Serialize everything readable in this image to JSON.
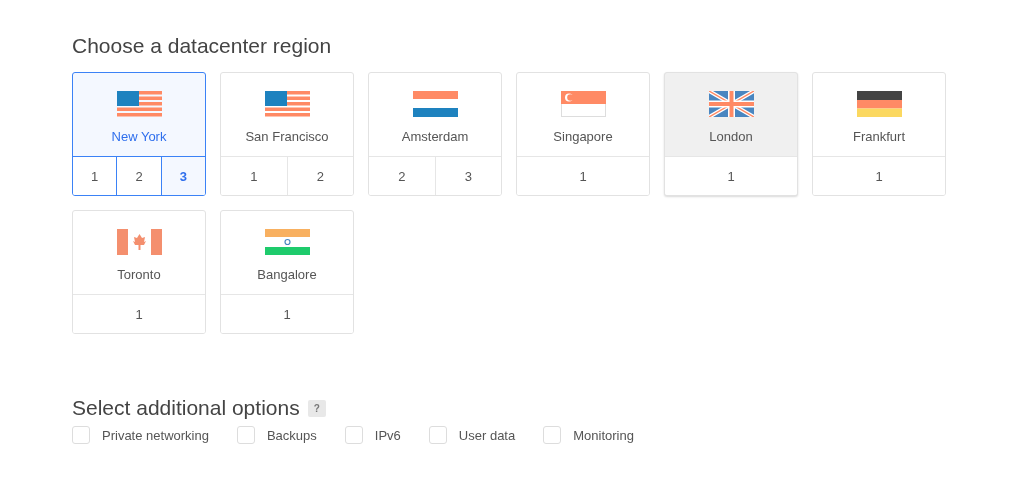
{
  "region_heading": "Choose a datacenter region",
  "regions": [
    {
      "name": "New York",
      "kind": "us",
      "selected": true,
      "highlighted": false,
      "datacenters": [
        {
          "label": "1",
          "selected": false
        },
        {
          "label": "2",
          "selected": false
        },
        {
          "label": "3",
          "selected": true
        }
      ]
    },
    {
      "name": "San Francisco",
      "kind": "us",
      "selected": false,
      "highlighted": false,
      "datacenters": [
        {
          "label": "1",
          "selected": false
        },
        {
          "label": "2",
          "selected": false
        }
      ]
    },
    {
      "name": "Amsterdam",
      "kind": "nl",
      "selected": false,
      "highlighted": false,
      "datacenters": [
        {
          "label": "2",
          "selected": false
        },
        {
          "label": "3",
          "selected": false
        }
      ]
    },
    {
      "name": "Singapore",
      "kind": "sg",
      "selected": false,
      "highlighted": false,
      "datacenters": [
        {
          "label": "1",
          "selected": false
        }
      ]
    },
    {
      "name": "London",
      "kind": "uk",
      "selected": false,
      "highlighted": true,
      "datacenters": [
        {
          "label": "1",
          "selected": false
        }
      ]
    },
    {
      "name": "Frankfurt",
      "kind": "de",
      "selected": false,
      "highlighted": false,
      "datacenters": [
        {
          "label": "1",
          "selected": false
        }
      ]
    },
    {
      "name": "Toronto",
      "kind": "ca",
      "selected": false,
      "highlighted": false,
      "datacenters": [
        {
          "label": "1",
          "selected": false
        }
      ]
    },
    {
      "name": "Bangalore",
      "kind": "in",
      "selected": false,
      "highlighted": false,
      "datacenters": [
        {
          "label": "1",
          "selected": false
        }
      ]
    }
  ],
  "options_heading": "Select additional options",
  "help_badge": "?",
  "options": [
    {
      "label": "Private networking",
      "checked": false
    },
    {
      "label": "Backups",
      "checked": false
    },
    {
      "label": "IPv6",
      "checked": false
    },
    {
      "label": "User data",
      "checked": false
    },
    {
      "label": "Monitoring",
      "checked": false
    }
  ]
}
